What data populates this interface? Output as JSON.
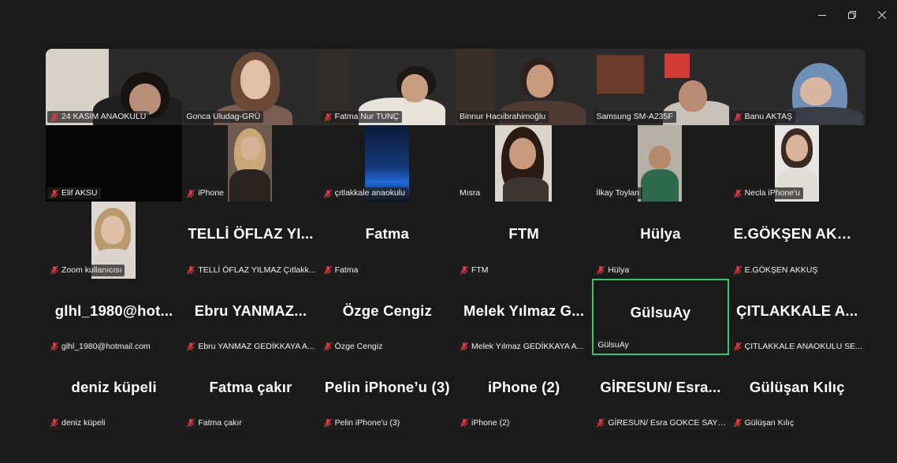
{
  "window_controls": [
    "minimize",
    "restore",
    "close"
  ],
  "active_speaker": "GülsuAy",
  "colors": {
    "background": "#1a1a1a",
    "tile": "#1a1a1a",
    "active_border": "#2dc86b",
    "muted_icon": "#e0383f",
    "text": "#ffffff"
  },
  "tiles": [
    {
      "label": "24 KASIM ANAOKULU",
      "video": true,
      "muted": true
    },
    {
      "label": "Gonca Uludag-GRÜ",
      "video": true,
      "muted": false
    },
    {
      "label": "Fatma Nur TUNÇ",
      "video": true,
      "muted": true
    },
    {
      "label": "Binnur Hacıibrahimoğlu",
      "video": true,
      "muted": false
    },
    {
      "label": "Samsung SM-A235F",
      "video": true,
      "muted": false
    },
    {
      "label": "Banu AKTAŞ",
      "video": true,
      "muted": true
    },
    {
      "label": "Elif AKSU",
      "video": true,
      "muted": true
    },
    {
      "label": "iPhone",
      "video": true,
      "muted": true
    },
    {
      "label": "çıtlakkale anaokulu",
      "video": true,
      "muted": true
    },
    {
      "label": "Mısra",
      "video": true,
      "muted": false
    },
    {
      "label": "İlkay Toylan",
      "video": true,
      "muted": false
    },
    {
      "label": "Necla iPhone'u",
      "video": true,
      "muted": true
    },
    {
      "label": "Zoom kullanıcısı",
      "video": true,
      "muted": true
    },
    {
      "display": "TELLİ ÖFLAZ YI...",
      "label": "TELLİ ÖFLAZ YILMAZ Çıtlakk...",
      "video": false,
      "muted": true
    },
    {
      "display": "Fatma",
      "label": "Fatma",
      "video": false,
      "muted": true
    },
    {
      "display": "FTM",
      "label": "FTM",
      "video": false,
      "muted": true
    },
    {
      "display": "Hülya",
      "label": "Hülya",
      "video": false,
      "muted": true
    },
    {
      "display": "E.GÖKŞEN AKKUŞ",
      "label": "E.GÖKŞEN AKKUŞ",
      "video": false,
      "muted": true
    },
    {
      "display": "glhl_1980@hot...",
      "label": "glhl_1980@hotmail.com",
      "video": false,
      "muted": true
    },
    {
      "display": "Ebru  YANMAZ...",
      "label": "Ebru YANMAZ GEDİKKAYA A...",
      "video": false,
      "muted": true
    },
    {
      "display": "Özge Cengiz",
      "label": "Özge Cengiz",
      "video": false,
      "muted": true
    },
    {
      "display": "Melek Yılmaz G...",
      "label": "Melek Yılmaz GEDİKKAYA A...",
      "video": false,
      "muted": true
    },
    {
      "display": "GülsuAy",
      "label": "GülsuAy",
      "video": false,
      "muted": false,
      "active": true
    },
    {
      "display": "ÇITLAKKALE  A...",
      "label": "ÇITLAKKALE ANAOKULU SE...",
      "video": false,
      "muted": true
    },
    {
      "display": "deniz küpeli",
      "label": "deniz küpeli",
      "video": false,
      "muted": true
    },
    {
      "display": "Fatma çakır",
      "label": "Fatma çakır",
      "video": false,
      "muted": true
    },
    {
      "display": "Pelin iPhone’u (3)",
      "label": "Pelin iPhone'u (3)",
      "video": false,
      "muted": true
    },
    {
      "display": "iPhone (2)",
      "label": "iPhone (2)",
      "video": false,
      "muted": true
    },
    {
      "display": "GİRESUN/  Esra...",
      "label": "GİRESUN/ Esra GOKCE SAYG...",
      "video": false,
      "muted": true
    },
    {
      "display": "Gülüşan Kılıç",
      "label": "Gülüşan Kılıç",
      "video": false,
      "muted": true
    }
  ]
}
